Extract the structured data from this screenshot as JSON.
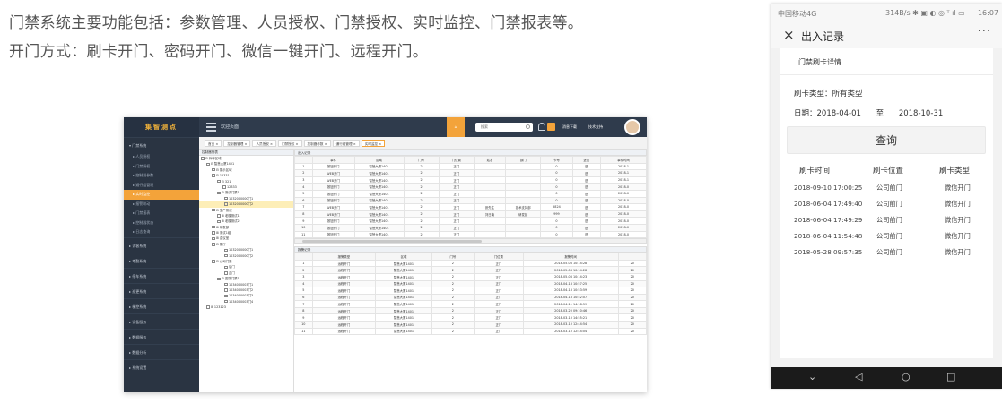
{
  "intro": {
    "line1": "门禁系统主要功能包括：参数管理、人员授权、门禁授权、实时监控、门禁报表等。",
    "line2": "开门方式：刷卡开门、密码开门、微信一键开门、远程开门。"
  },
  "desktop": {
    "logo": "集智测点",
    "header_title": "欢迎页面",
    "search_placeholder": "搜索",
    "top_buttons": [
      "消息下载",
      "技术支持"
    ],
    "sidebar": [
      {
        "label": "▾ 门禁系统",
        "type": "group"
      },
      {
        "label": "▸ 人员授权",
        "type": "sub"
      },
      {
        "label": "▸ 门禁授权",
        "type": "sub"
      },
      {
        "label": "▸ 控制器参数",
        "type": "sub"
      },
      {
        "label": "▸ 通行组管理",
        "type": "sub"
      },
      {
        "label": "▸ 实时监控",
        "type": "active"
      },
      {
        "label": "▸ 报警联动",
        "type": "sub"
      },
      {
        "label": "▸ 门禁报表",
        "type": "sub"
      },
      {
        "label": "▸ 控制器状态",
        "type": "sub"
      },
      {
        "label": "▸ 日志查询",
        "type": "sub"
      },
      {
        "label": "▸ 访客系统",
        "type": "group"
      },
      {
        "label": "▸ 考勤系统",
        "type": "group"
      },
      {
        "label": "▸ 停车系统",
        "type": "group"
      },
      {
        "label": "▸ 巡更系统",
        "type": "group"
      },
      {
        "label": "▸ 梯控系统",
        "type": "group"
      },
      {
        "label": "▸ 设备服务",
        "type": "group"
      },
      {
        "label": "▸ 数据服务",
        "type": "group"
      },
      {
        "label": "▸ 数据分析",
        "type": "group"
      },
      {
        "label": "▸ 系统设置",
        "type": "group"
      }
    ],
    "tabs": [
      "首页 ×",
      "控制器管理 ×",
      "人员授权 ×",
      "门禁授权 ×",
      "控制器参数 ×",
      "通行组管理 ×",
      "实时监控 ×"
    ],
    "tree_title": "控制器列表",
    "tree": [
      {
        "label": "⊟ 外埠区域",
        "indent": 2,
        "sel": false
      },
      {
        "label": "⊟ 智慧大厦1401",
        "indent": 8,
        "sel": false
      },
      {
        "label": "⊟ 展示区域",
        "indent": 14,
        "sel": false
      },
      {
        "label": "⊟ 12331",
        "indent": 14,
        "sel": false
      },
      {
        "label": "⊟ 321",
        "indent": 20,
        "sel": false
      },
      {
        "label": "12333",
        "indent": 26,
        "sel": false
      },
      {
        "label": "⊟ 测试门禁1",
        "indent": 20,
        "sel": false
      },
      {
        "label": "1032000000门1",
        "indent": 28,
        "sel": false
      },
      {
        "label": "1032000000门2",
        "indent": 28,
        "sel": true
      },
      {
        "label": "⊟ 生产测试",
        "indent": 14,
        "sel": false
      },
      {
        "label": "⊞ 老楼测试1",
        "indent": 20,
        "sel": false
      },
      {
        "label": "⊞ 老楼测试2",
        "indent": 20,
        "sel": false
      },
      {
        "label": "⊞ 研发部",
        "indent": 14,
        "sel": false
      },
      {
        "label": "⊞ 测试1组",
        "indent": 14,
        "sel": false
      },
      {
        "label": "⊞ 会议室",
        "indent": 14,
        "sel": false
      },
      {
        "label": "⊟ 展厅",
        "indent": 14,
        "sel": false
      },
      {
        "label": "1032000000门1",
        "indent": 28,
        "sel": false
      },
      {
        "label": "1032000000门2",
        "indent": 28,
        "sel": false
      },
      {
        "label": "⊟ 公司门禁",
        "indent": 14,
        "sel": false
      },
      {
        "label": "后门",
        "indent": 28,
        "sel": false
      },
      {
        "label": "正门",
        "indent": 28,
        "sel": false
      },
      {
        "label": "⊟ 四防门禁1",
        "indent": 20,
        "sel": false
      },
      {
        "label": "1034000003门1",
        "indent": 28,
        "sel": false
      },
      {
        "label": "1034000003门2",
        "indent": 28,
        "sel": false
      },
      {
        "label": "1034000003门3",
        "indent": 28,
        "sel": false
      },
      {
        "label": "1034000003门4",
        "indent": 28,
        "sel": false
      },
      {
        "label": "⊞ 123123",
        "indent": 8,
        "sel": false
      }
    ],
    "entry_title": "出入记录",
    "entry_headers": [
      "",
      "事件",
      "区域",
      "门号",
      "门位置",
      "姓名",
      "部门",
      "卡号",
      "进出",
      "事件时间"
    ],
    "entry_rows": [
      [
        "1",
        "按钮开门",
        "智慧大厦1401",
        "2",
        "正门",
        "",
        "",
        "0",
        "进",
        "2018-1"
      ],
      [
        "2",
        "WEB开门",
        "智慧大厦1401",
        "2",
        "正门",
        "",
        "",
        "0",
        "进",
        "2018-1"
      ],
      [
        "3",
        "WEB开门",
        "智慧大厦1401",
        "2",
        "正门",
        "",
        "",
        "0",
        "进",
        "2018-1"
      ],
      [
        "4",
        "按钮开门",
        "智慧大厦1401",
        "2",
        "正门",
        "",
        "",
        "0",
        "进",
        "2018-0"
      ],
      [
        "5",
        "按钮开门",
        "智慧大厦1401",
        "2",
        "正门",
        "",
        "",
        "0",
        "进",
        "2018-0"
      ],
      [
        "6",
        "按钮开门",
        "智慧大厦1401",
        "2",
        "正门",
        "",
        "",
        "0",
        "进",
        "2018-0"
      ],
      [
        "7",
        "WEB开门",
        "智慧大厦1401",
        "2",
        "正门",
        "张先生",
        "技术支持部",
        "5824",
        "进",
        "2018-0"
      ],
      [
        "8",
        "WEB开门",
        "智慧大厦1401",
        "2",
        "正门",
        "刘日南",
        "研发部",
        "999",
        "进",
        "2018-0"
      ],
      [
        "9",
        "按钮开门",
        "智慧大厦1401",
        "2",
        "正门",
        "",
        "",
        "0",
        "进",
        "2018-0"
      ],
      [
        "10",
        "按钮开门",
        "智慧大厦1401",
        "2",
        "正门",
        "",
        "",
        "0",
        "进",
        "2018-0"
      ],
      [
        "11",
        "按钮开门",
        "智慧大厦1401",
        "2",
        "正门",
        "",
        "",
        "0",
        "进",
        "2018-0"
      ]
    ],
    "alarm_title": "报警记录",
    "alarm_headers": [
      "",
      "报警类型",
      "区域",
      "门号",
      "门位置",
      "报警时间",
      ""
    ],
    "alarm_rows": [
      [
        "1",
        "远程开门",
        "智慧大厦1401",
        "2",
        "正门",
        "2018-05-08 10:14:28",
        "20"
      ],
      [
        "2",
        "远程开门",
        "智慧大厦1401",
        "2",
        "正门",
        "2018-05-08 10:14:28",
        "20"
      ],
      [
        "3",
        "远程开门",
        "智慧大厦1401",
        "2",
        "正门",
        "2018-05-08 10:14:23",
        "20"
      ],
      [
        "4",
        "远程开门",
        "智慧大厦1401",
        "2",
        "正门",
        "2018-04-13 10:57:25",
        "20"
      ],
      [
        "5",
        "远程开门",
        "智慧大厦1401",
        "2",
        "正门",
        "2018-04-13 10:53:59",
        "20"
      ],
      [
        "6",
        "远程开门",
        "智慧大厦1401",
        "2",
        "正门",
        "2018-04-13 10:52:07",
        "20"
      ],
      [
        "7",
        "远程开门",
        "智慧大厦1401",
        "2",
        "正门",
        "2018-04-11 14:18:59",
        "20"
      ],
      [
        "8",
        "远程开门",
        "智慧大厦1401",
        "2",
        "正门",
        "2018-03-20 09:10:46",
        "20"
      ],
      [
        "9",
        "远程开门",
        "智慧大厦1401",
        "2",
        "正门",
        "2018-03-10 14:55:21",
        "20"
      ],
      [
        "10",
        "远程开门",
        "智慧大厦1401",
        "2",
        "正门",
        "2018-03-10 12:44:54",
        "20"
      ],
      [
        "11",
        "远程开门",
        "智慧大厦1401",
        "2",
        "正门",
        "2018-03-10 12:44:04",
        "20"
      ]
    ]
  },
  "phone": {
    "status": {
      "carrier": "中国移动4G",
      "speed": "314B/s ✱ ▣ ◐ ◎ ᵀ ıl ▭",
      "time": "16:07"
    },
    "close_icon": "×",
    "title": "出入记录",
    "more_icon": "···",
    "detail_header": "门禁刷卡详情",
    "card_type_label": "刷卡类型：所有类型",
    "date_label": "日期：2018-04-01",
    "date_to": "至",
    "date_end": "2018-10-31",
    "query_button": "查询",
    "columns": [
      "刷卡时间",
      "刷卡位置",
      "刷卡类型"
    ],
    "rows": [
      [
        "2018-09-10 17:00:25",
        "公司前门",
        "微信开门"
      ],
      [
        "2018-06-04 17:49:40",
        "公司前门",
        "微信开门"
      ],
      [
        "2018-06-04 17:49:29",
        "公司前门",
        "微信开门"
      ],
      [
        "2018-06-04 11:54:48",
        "公司前门",
        "微信开门"
      ],
      [
        "2018-05-28 09:57:35",
        "公司前门",
        "微信开门"
      ]
    ]
  }
}
